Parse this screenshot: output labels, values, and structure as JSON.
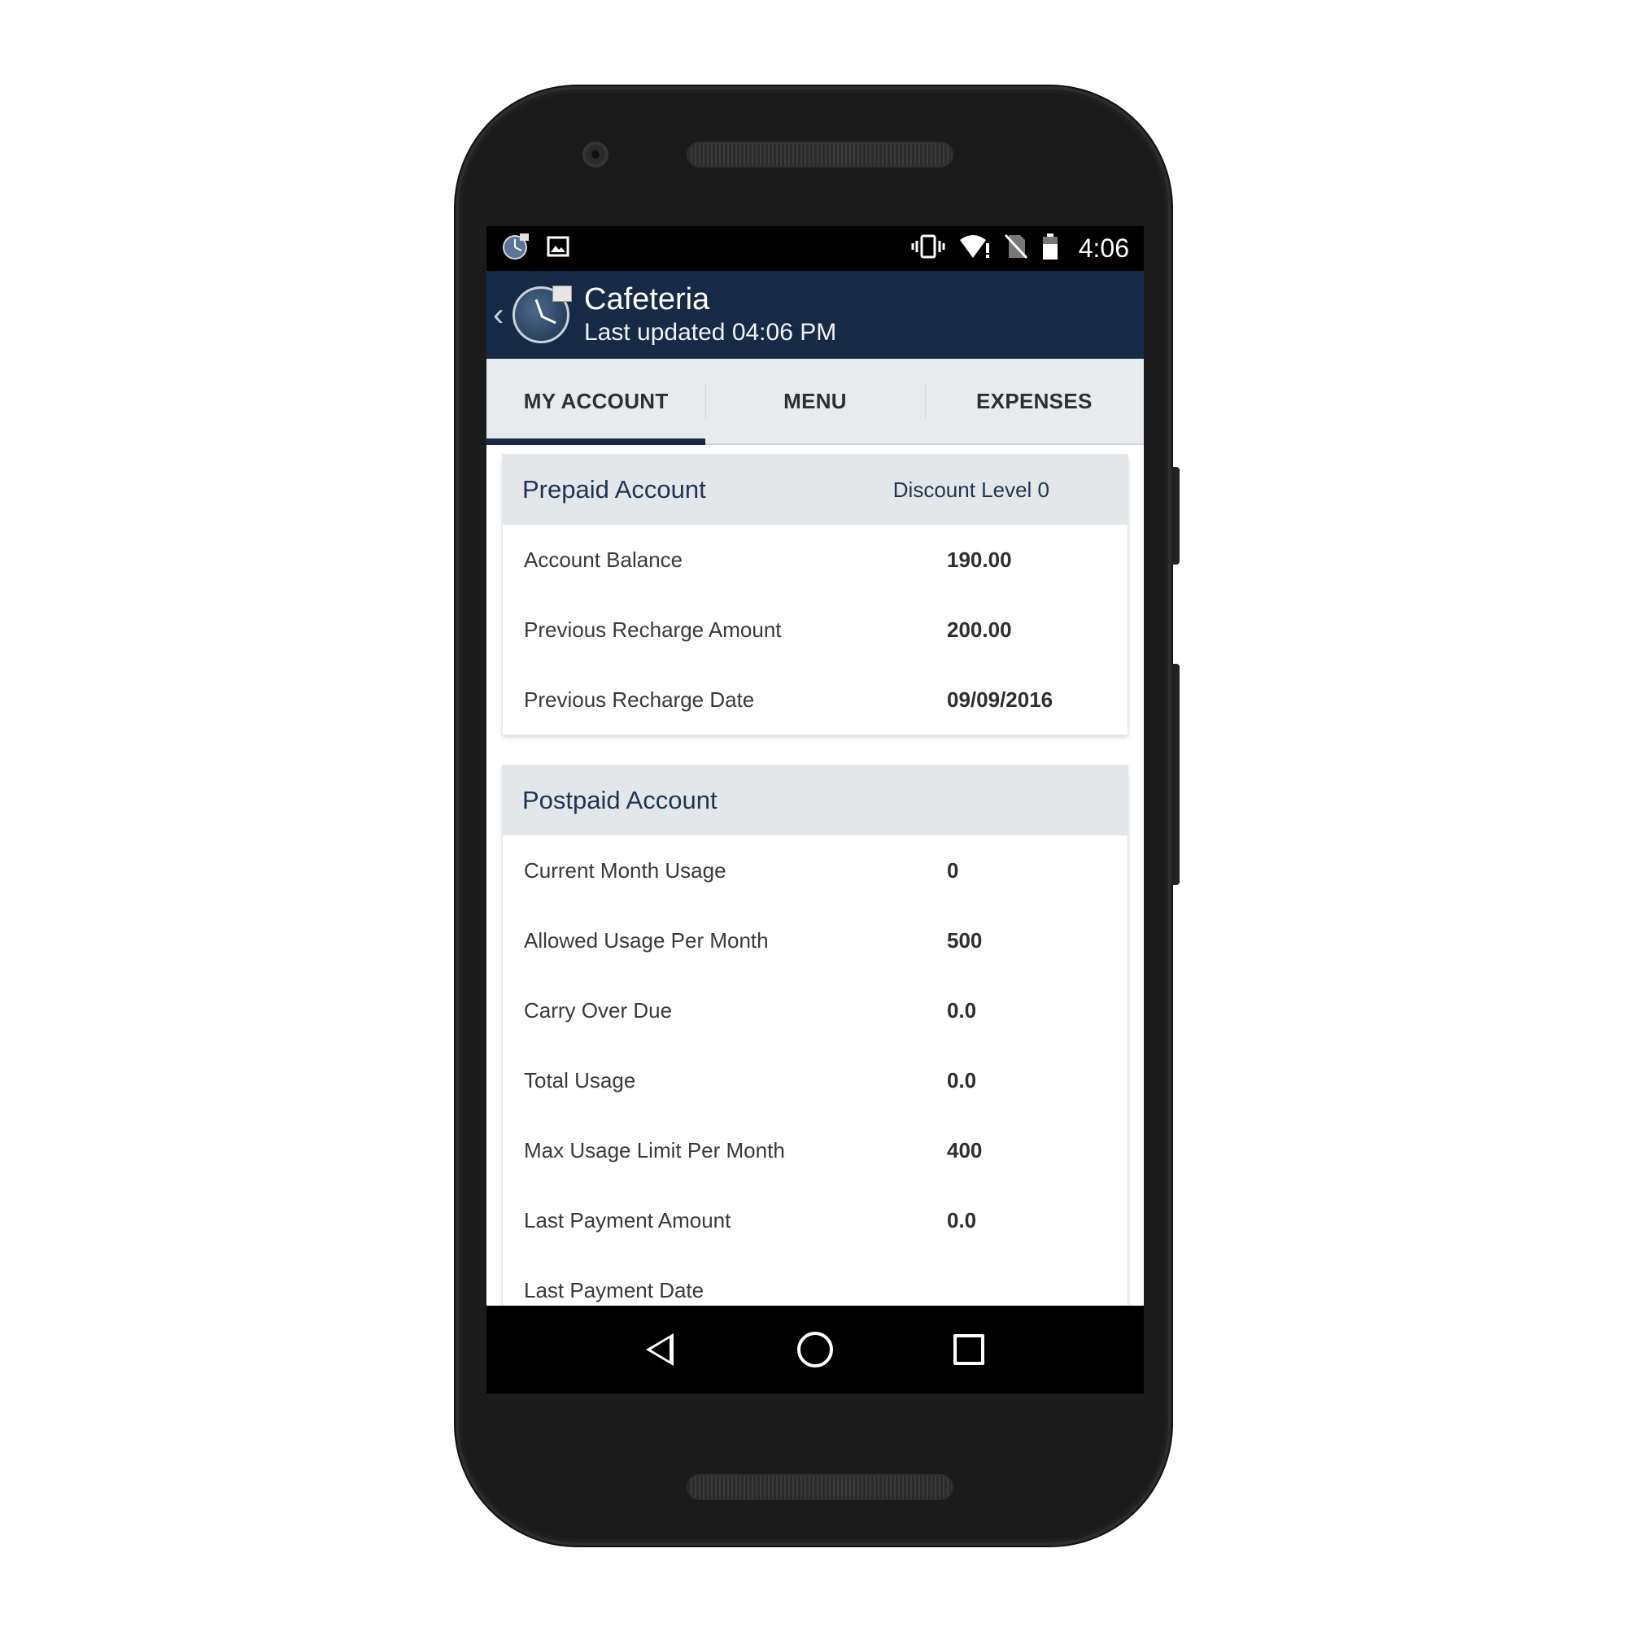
{
  "status_bar": {
    "time": "4:06",
    "left_icons": [
      "app-notification-icon",
      "image-icon"
    ],
    "right_icons": [
      "vibrate-icon",
      "wifi-alert-icon",
      "no-sim-icon",
      "battery-icon"
    ]
  },
  "app_bar": {
    "title": "Cafeteria",
    "subtitle": "Last updated 04:06 PM",
    "back_glyph": "‹"
  },
  "tabs": [
    {
      "label": "MY ACCOUNT",
      "active": true
    },
    {
      "label": "MENU",
      "active": false
    },
    {
      "label": "EXPENSES",
      "active": false
    }
  ],
  "prepaid": {
    "title": "Prepaid Account",
    "discount": "Discount Level 0",
    "rows": [
      {
        "label": "Account Balance",
        "value": "190.00"
      },
      {
        "label": "Previous Recharge Amount",
        "value": "200.00"
      },
      {
        "label": "Previous Recharge Date",
        "value": "09/09/2016"
      }
    ]
  },
  "postpaid": {
    "title": "Postpaid Account",
    "rows": [
      {
        "label": "Current Month Usage",
        "value": "0"
      },
      {
        "label": "Allowed Usage Per Month",
        "value": "500"
      },
      {
        "label": "Carry Over Due",
        "value": "0.0"
      },
      {
        "label": "Total Usage",
        "value": "0.0"
      },
      {
        "label": "Max Usage Limit Per Month",
        "value": "400"
      },
      {
        "label": "Last Payment Amount",
        "value": "0.0"
      },
      {
        "label": "Last Payment Date",
        "value": ""
      }
    ]
  },
  "colors": {
    "app_bar": "#162a45",
    "tab_bg": "#e8ebee",
    "card_header": "#e3e7ea",
    "accent_text": "#1d3553"
  },
  "nav": [
    "back-icon",
    "home-icon",
    "recents-icon"
  ]
}
